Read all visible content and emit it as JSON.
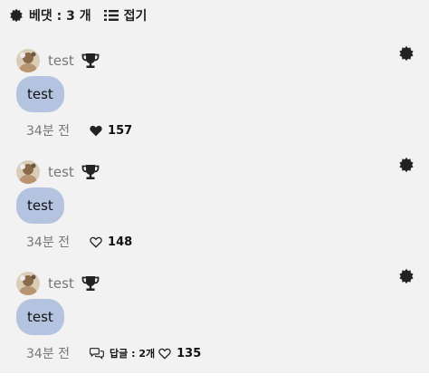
{
  "header": {
    "comment_label": "베댓 : 3 개",
    "collapse_label": "접기"
  },
  "comments": [
    {
      "username": "test",
      "text": "test",
      "time": "34분 전",
      "liked": true,
      "likes": "157",
      "reply_label": ""
    },
    {
      "username": "test",
      "text": "test",
      "time": "34분 전",
      "liked": false,
      "likes": "148",
      "reply_label": ""
    },
    {
      "username": "test",
      "text": "test",
      "time": "34분 전",
      "liked": false,
      "likes": "135",
      "reply_label": "답글 : 2개"
    }
  ],
  "icons": {
    "header_badge": "badge-icon",
    "collapse": "list-icon",
    "trophy": "trophy-icon",
    "more": "badge-menu-icon",
    "like_filled": "heart-filled-icon",
    "like_outline": "heart-outline-icon",
    "reply": "chat-bubbles-icon"
  },
  "colors": {
    "panel_bg": "#f2f2f2",
    "bubble_bg": "#b4c4e0",
    "muted_text": "#777777"
  }
}
